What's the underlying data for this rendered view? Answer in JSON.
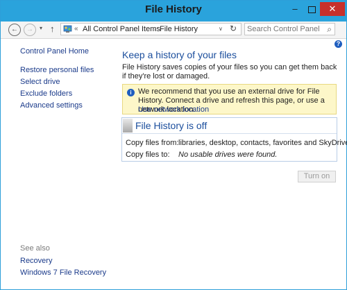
{
  "window": {
    "title": "File History",
    "minimize": "–",
    "close": "✕"
  },
  "nav": {
    "back": "←",
    "forward": "→",
    "recent": "▾",
    "up": "↑",
    "address_sep": "«",
    "breadcrumb": [
      "All Control Panel Items",
      "File History"
    ],
    "breadcrumb_sep": "›",
    "address_drop": "∨",
    "refresh": "↻",
    "search_placeholder": "Search Control Panel",
    "search_glyph": "⌕"
  },
  "help": "?",
  "sidebar": {
    "home": "Control Panel Home",
    "items": [
      "Restore personal files",
      "Select drive",
      "Exclude folders",
      "Advanced settings"
    ],
    "see_also_label": "See also",
    "see_also": [
      "Recovery",
      "Windows 7 File Recovery"
    ]
  },
  "main": {
    "heading": "Keep a history of your files",
    "description": "File History saves copies of your files so you can get them back if they're lost or damaged.",
    "info": {
      "icon": "i",
      "text": "We recommend that you use an external drive for File History. Connect a drive and refresh this page, or use a network location.",
      "link": "Use network location"
    },
    "status": {
      "title": "File History is off",
      "copy_from_label": "Copy files from:",
      "copy_from_value": "libraries, desktop, contacts, favorites and SkyDrive",
      "copy_to_label": "Copy files to:",
      "copy_to_value": "No usable drives were found."
    },
    "turn_on": "Turn on"
  },
  "colors": {
    "titlebar": "#2aa3dc",
    "close": "#c7302b",
    "link": "#1a3a8a",
    "heading": "#1a4d9c",
    "info_bg": "#fdf7c9"
  }
}
